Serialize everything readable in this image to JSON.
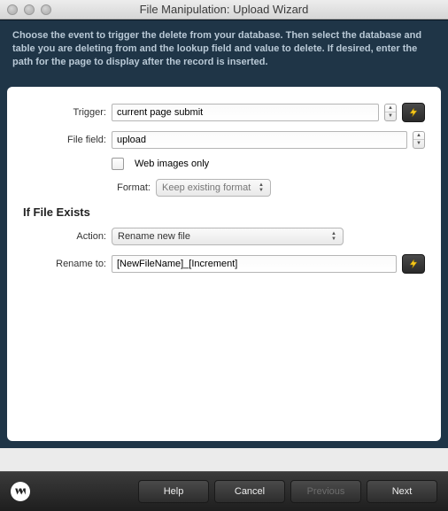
{
  "window": {
    "title": "File Manipulation: Upload Wizard"
  },
  "header": {
    "instructions": "Choose the event to trigger the delete from your database. Then select the database and table you are deleting from and the lookup field and value to delete. If desired, enter the path for the page to display after the record is inserted."
  },
  "form": {
    "trigger": {
      "label": "Trigger:",
      "value": "current page submit"
    },
    "filefield": {
      "label": "File field:",
      "value": "upload"
    },
    "webimages": {
      "label": "Web images only",
      "checked": false
    },
    "format": {
      "label": "Format:",
      "selected": "Keep existing format"
    },
    "section_title": "If File Exists",
    "action": {
      "label": "Action:",
      "selected": "Rename new file"
    },
    "rename": {
      "label": "Rename to:",
      "value": "[NewFileName]_[Increment]"
    }
  },
  "footer": {
    "help": "Help",
    "cancel": "Cancel",
    "previous": "Previous",
    "next": "Next"
  }
}
